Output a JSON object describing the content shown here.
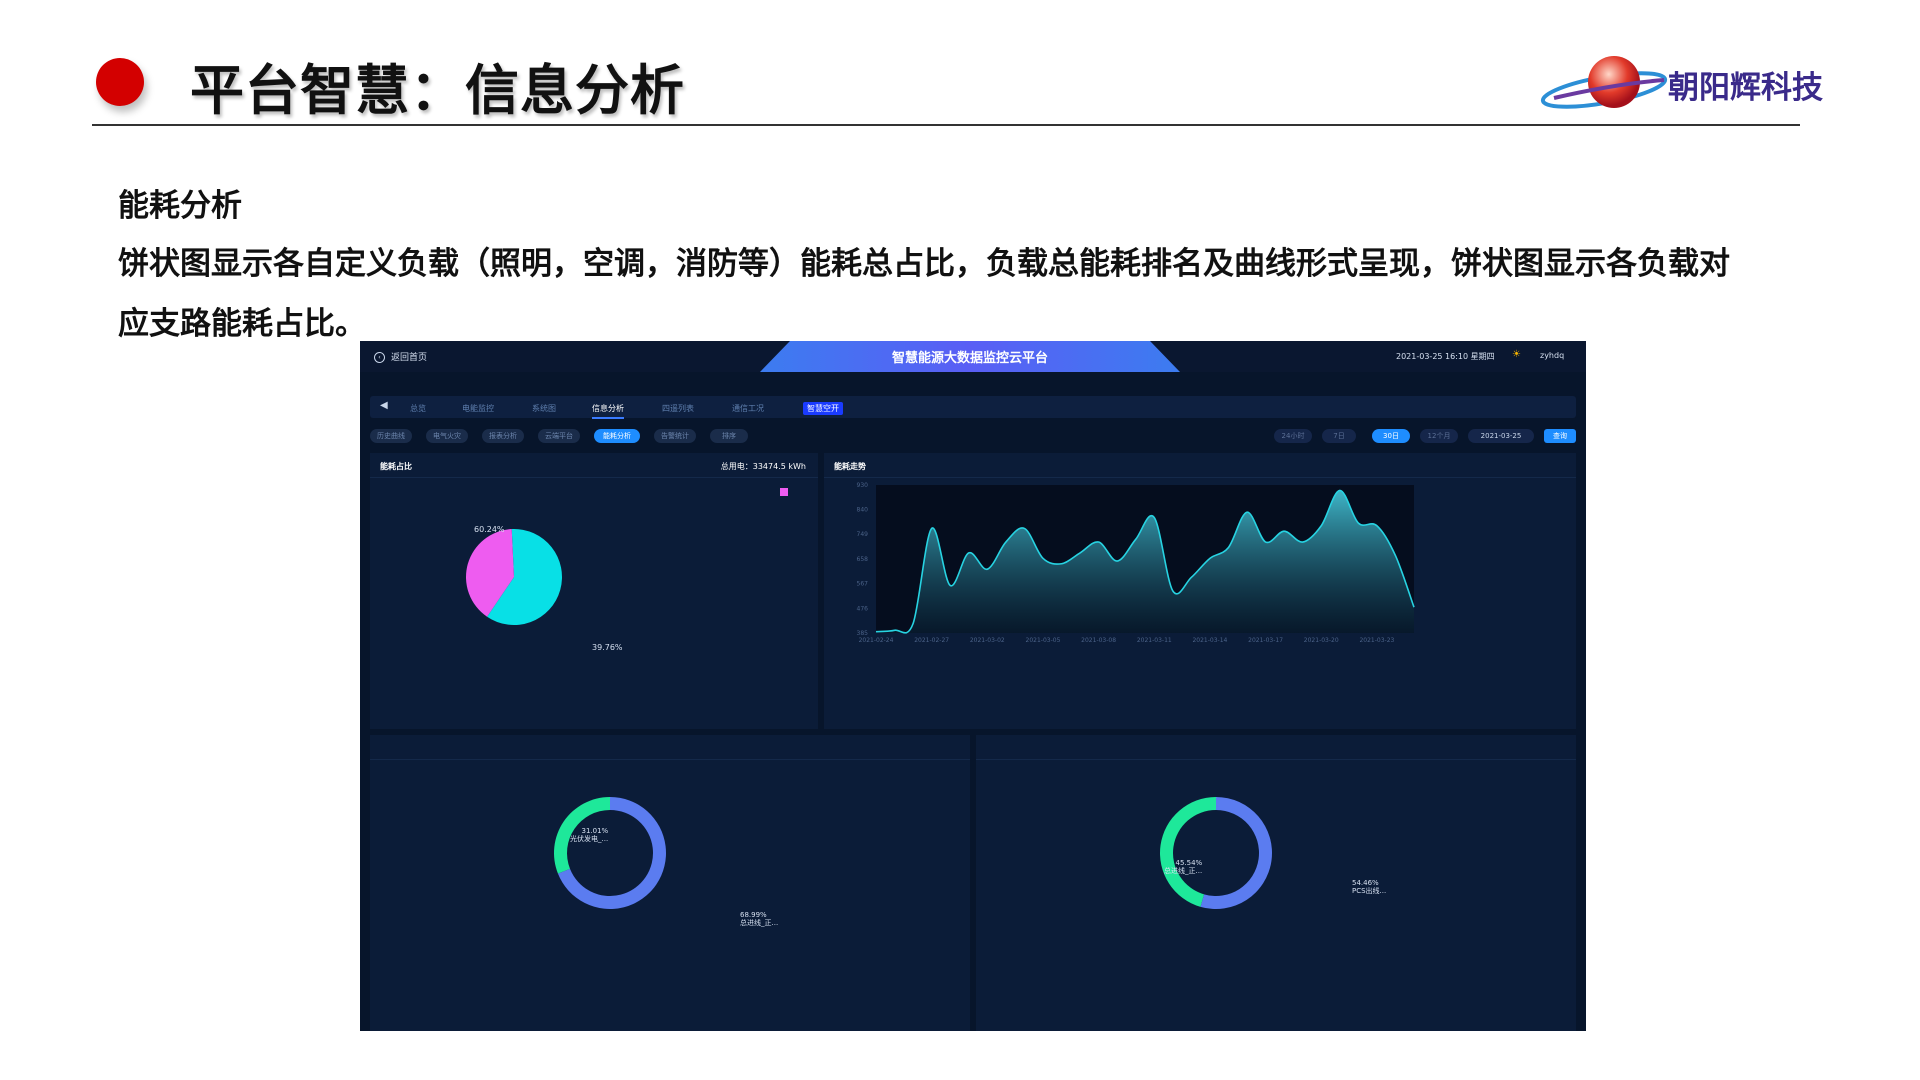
{
  "slide": {
    "title": "平台智慧：信息分析",
    "logo_text": "朝阳辉科技",
    "section_title": "能耗分析",
    "description": "饼状图显示各自定义负载（照明，空调，消防等）能耗总占比，负载总能耗排名及曲线形式呈现，饼状图显示各负载对应支路能耗占比。"
  },
  "dashboard": {
    "title": "智慧能源大数据监控云平台",
    "back_label": "返回首页",
    "datetime": "2021-03-25 16:10 星期四",
    "user": "zyhdq",
    "nav": [
      "总览",
      "电能监控",
      "系统图",
      "信息分析",
      "四遥列表",
      "通信工况",
      "智慧空开"
    ],
    "subtabs": [
      "历史曲线",
      "电气火灾",
      "报表分析",
      "云端平台",
      "能耗分析",
      "告警统计",
      "排序"
    ],
    "ranges": [
      "24小时",
      "7日",
      "30日",
      "12个月"
    ],
    "date": "2021-03-25",
    "query_label": "查询",
    "panel_share": {
      "title": "能耗占比",
      "total": "总用电：33474.5 kWh"
    },
    "panel_trend": {
      "title": "能耗走势"
    },
    "donut_left": {
      "label_a": "31.01%",
      "label_a_name": "光伏发电_...",
      "label_b": "68.99%",
      "label_b_name": "总进线_正..."
    },
    "donut_right": {
      "label_a": "45.54%",
      "label_a_name": "总进线_正...",
      "label_b": "54.46%",
      "label_b_name": "PCS出线..."
    }
  },
  "colors": {
    "cyan": "#08e0e6",
    "magenta": "#ee5cf0",
    "green": "#1ee89a",
    "blue": "#5b7cf0",
    "accent": "#1e8dff"
  },
  "chart_data": [
    {
      "type": "pie",
      "title": "能耗占比",
      "labels": [
        "60.24%",
        "39.76%"
      ],
      "values": [
        60.24,
        39.76
      ],
      "colors": [
        "#08e0e6",
        "#ee5cf0"
      ]
    },
    {
      "type": "area",
      "title": "能耗走势",
      "ylim": [
        385,
        930
      ],
      "yticks": [
        385,
        476,
        567,
        658,
        749,
        840,
        930
      ],
      "x_tick_labels": [
        "2021-02-24",
        "2021-02-27",
        "2021-03-02",
        "2021-03-05",
        "2021-03-08",
        "2021-03-11",
        "2021-03-14",
        "2021-03-17",
        "2021-03-20",
        "2021-03-23"
      ],
      "x": [
        "02-24",
        "02-25",
        "02-26",
        "02-27",
        "02-28",
        "03-01",
        "03-02",
        "03-03",
        "03-04",
        "03-05",
        "03-06",
        "03-07",
        "03-08",
        "03-09",
        "03-10",
        "03-11",
        "03-12",
        "03-13",
        "03-14",
        "03-15",
        "03-16",
        "03-17",
        "03-18",
        "03-19",
        "03-20",
        "03-21",
        "03-22",
        "03-23",
        "03-24",
        "03-25"
      ],
      "values": [
        390,
        395,
        420,
        770,
        560,
        680,
        620,
        720,
        770,
        660,
        640,
        680,
        720,
        650,
        730,
        810,
        540,
        590,
        660,
        700,
        830,
        720,
        760,
        720,
        780,
        910,
        790,
        780,
        670,
        480
      ]
    },
    {
      "type": "pie",
      "labels": [
        "31.01%",
        "68.99%"
      ],
      "values": [
        31.01,
        68.99
      ],
      "colors": [
        "#1ee89a",
        "#5b7cf0"
      ]
    },
    {
      "type": "pie",
      "labels": [
        "45.54%",
        "54.46%"
      ],
      "values": [
        45.54,
        54.46
      ],
      "colors": [
        "#1ee89a",
        "#5b7cf0"
      ]
    }
  ]
}
